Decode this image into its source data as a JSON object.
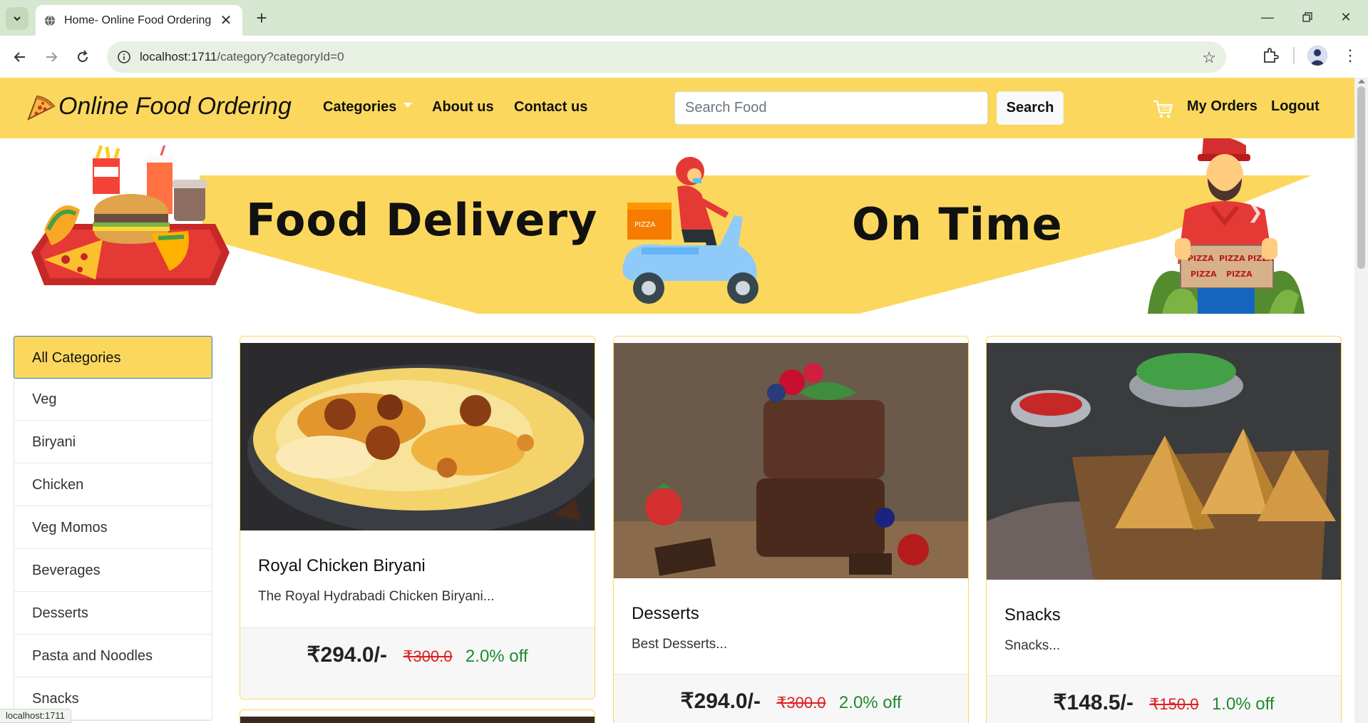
{
  "browser": {
    "tab_title": "Home- Online Food Ordering",
    "url_host": "localhost:1711",
    "url_path": "/category?categoryId=0",
    "status_url": "localhost:1711"
  },
  "nav": {
    "brand": "Online Food Ordering",
    "categories": "Categories",
    "about": "About us",
    "contact": "Contact us",
    "search_placeholder": "Search Food",
    "search_button": "Search",
    "my_orders": "My Orders",
    "logout": "Logout"
  },
  "banner": {
    "line1": "Food Delivery",
    "line2": "On Time",
    "box_text": "PIZZA"
  },
  "sidebar": {
    "items": [
      {
        "label": "All Categories",
        "active": true
      },
      {
        "label": "Veg"
      },
      {
        "label": "Biryani"
      },
      {
        "label": "Chicken"
      },
      {
        "label": "Veg Momos"
      },
      {
        "label": "Beverages"
      },
      {
        "label": "Desserts"
      },
      {
        "label": "Pasta and Noodles"
      },
      {
        "label": "Snacks"
      }
    ]
  },
  "cards": [
    {
      "title": "Royal Chicken Biryani",
      "desc": "The Royal Hydrabadi Chicken Biryani...",
      "price": "₹294.0/-",
      "mrp": "₹300.0",
      "off": "2.0% off"
    },
    {
      "title": "Desserts",
      "desc": "Best Desserts...",
      "price": "₹294.0/-",
      "mrp": "₹300.0",
      "off": "2.0% off"
    },
    {
      "title": "Snacks",
      "desc": "Snacks...",
      "price": "₹148.5/-",
      "mrp": "₹150.0",
      "off": "1.0% off"
    }
  ],
  "colors": {
    "brand_yellow": "#fbd85d",
    "tab_strip": "#d6e7cf",
    "discount_green": "#1e8a2e",
    "mrp_red": "#e02020"
  }
}
